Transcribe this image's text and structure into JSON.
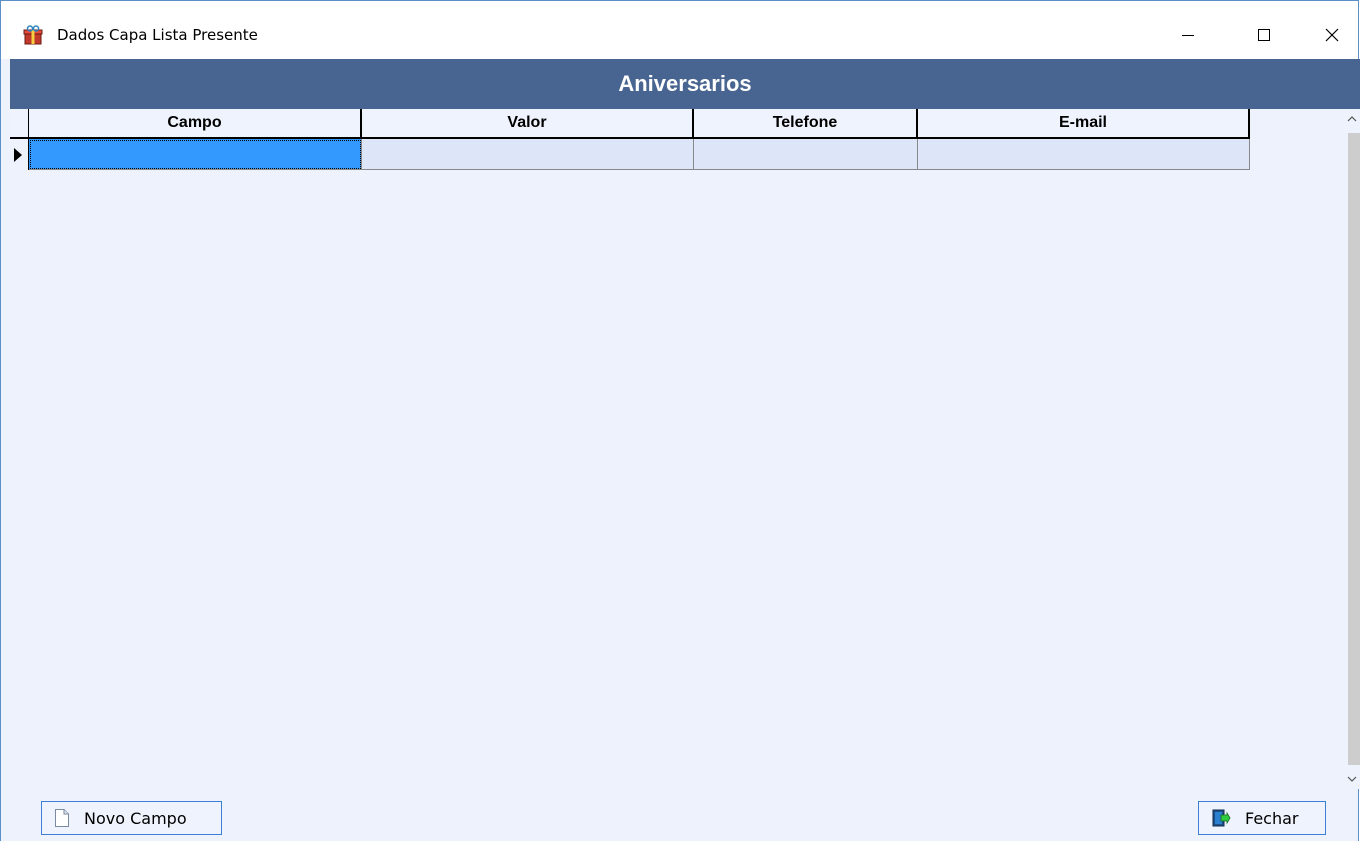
{
  "window": {
    "title": "Dados Capa Lista Presente",
    "controls": [
      "minimize",
      "maximize",
      "close"
    ]
  },
  "header": {
    "title": "Aniversarios",
    "background_color": "#476590"
  },
  "grid": {
    "columns": [
      "Campo",
      "Valor",
      "Telefone",
      "E-mail"
    ],
    "rows": [
      {
        "cells": [
          "",
          "",
          "",
          ""
        ],
        "selected_cell": 0
      }
    ],
    "selection_color": "#3399ff"
  },
  "buttons": {
    "novo_campo": {
      "label": "Novo Campo",
      "icon": "document-icon"
    },
    "fechar": {
      "label": "Fechar",
      "icon": "exit-door-icon"
    }
  }
}
